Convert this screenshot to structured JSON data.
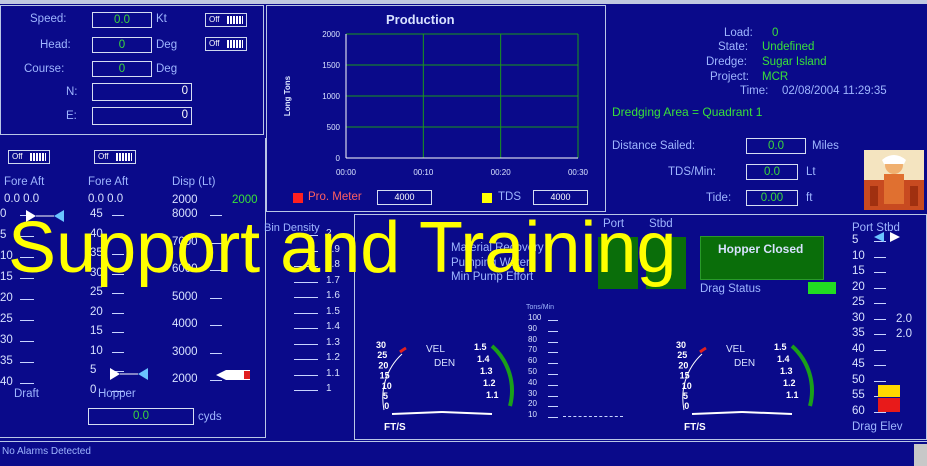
{
  "nav": {
    "speed_label": "Speed:",
    "speed_value": "0.0",
    "speed_unit": "Kt",
    "head_label": "Head:",
    "head_value": "0",
    "head_unit": "Deg",
    "course_label": "Course:",
    "course_value": "0",
    "course_unit": "Deg",
    "n_label": "N:",
    "n_value": "0",
    "e_label": "E:",
    "e_value": "0",
    "toggle_off": "Off"
  },
  "production": {
    "title": "Production",
    "ylabel": "Long Tons",
    "pro_meter_label": "Pro. Meter",
    "pro_meter_value": "4000",
    "tds_label": "TDS",
    "tds_value": "4000"
  },
  "chart_data": {
    "type": "line",
    "title": "Production",
    "ylabel": "Long Tons",
    "xlabel": "",
    "x": [
      "00:00",
      "00:10",
      "00:20",
      "00:30"
    ],
    "y_ticks": [
      0,
      500,
      1000,
      1500,
      2000
    ],
    "ylim": [
      0,
      2000
    ],
    "grid": true,
    "series": [
      {
        "name": "Pro. Meter",
        "color": "#ff2020",
        "values": []
      },
      {
        "name": "TDS",
        "color": "#ffff00",
        "values": []
      }
    ]
  },
  "status": {
    "load_label": "Load:",
    "load_value": "0",
    "state_label": "State:",
    "state_value": "Undefined",
    "dredge_label": "Dredge:",
    "dredge_value": "Sugar Island",
    "project_label": "Project:",
    "project_value": "MCR",
    "time_label": "Time:",
    "time_value": "02/08/2004 11:29:35",
    "area_text": "Dredging Area = Quadrant 1",
    "distance_label": "Distance Sailed:",
    "distance_value": "0.0",
    "distance_unit": "Miles",
    "tds_min_label": "TDS/Min:",
    "tds_min_value": "0.0",
    "tds_min_unit": "Lt",
    "tide_label": "Tide:",
    "tide_value": "0.00",
    "tide_unit": "ft"
  },
  "draft": {
    "fore_aft_label": "Fore  Aft",
    "fore_aft_label2": "Fore  Aft",
    "disp_label": "Disp (Lt)",
    "fore_aft_values": "0.0  0.0",
    "fore_aft_values2": "0.0  0.0",
    "disp_value_a": "2000",
    "disp_value_b": "2000",
    "draft_label": "Draft",
    "hopper_label": "Hopper",
    "draft_scale": [
      "0",
      "5",
      "10",
      "15",
      "20",
      "25",
      "30",
      "35",
      "40"
    ],
    "hopper_scale": [
      "45",
      "40",
      "35",
      "30",
      "25",
      "20",
      "15",
      "10",
      "5",
      "0"
    ],
    "disp_scale": [
      "8000",
      "7000",
      "6000",
      "5000",
      "4000",
      "3000",
      "2000"
    ],
    "cyds_value": "0.0",
    "cyds_unit": "cyds",
    "bin_density_label": "Bin Density",
    "bin_scale": [
      "2",
      "1.9",
      "1.8",
      "1.7",
      "1.6",
      "1.5",
      "1.4",
      "1.3",
      "1.2",
      "1.1",
      "1"
    ]
  },
  "pump": {
    "port_label": "Port",
    "stbd_label": "Stbd",
    "material_recovery": "Material Recovery",
    "pumping_water": "Pumping Water",
    "min_pump_effort": "Min Pump Effort",
    "hopper_closed": "Hopper Closed",
    "drag_status": "Drag Status",
    "tons_min": "Tons/Min",
    "tons_scale": [
      "100",
      "90",
      "80",
      "70",
      "60",
      "50",
      "40",
      "30",
      "20",
      "10"
    ],
    "vel_label": "VEL",
    "den_label": "DEN",
    "fts_label": "FT/S",
    "vel_ticks": [
      "30",
      "25",
      "20",
      "15",
      "10",
      "5",
      "0"
    ],
    "den_ticks": [
      "1.5",
      "1.4",
      "1.3",
      "1.2",
      "1.1"
    ],
    "port_stbd_label": "Port Stbd",
    "drag_elev_label": "Drag Elev",
    "elev_scale": [
      "5",
      "10",
      "15",
      "20",
      "25",
      "30",
      "35",
      "40",
      "45",
      "50",
      "55",
      "60"
    ],
    "elev_values": [
      "2.0",
      "2.0"
    ]
  },
  "footer": {
    "alarm_text": "No Alarms Detected"
  },
  "overlay_text": "Support and Training",
  "colors": {
    "background": "#0a0a8a",
    "green_value": "#39e039",
    "overlay": "#ffff00"
  }
}
